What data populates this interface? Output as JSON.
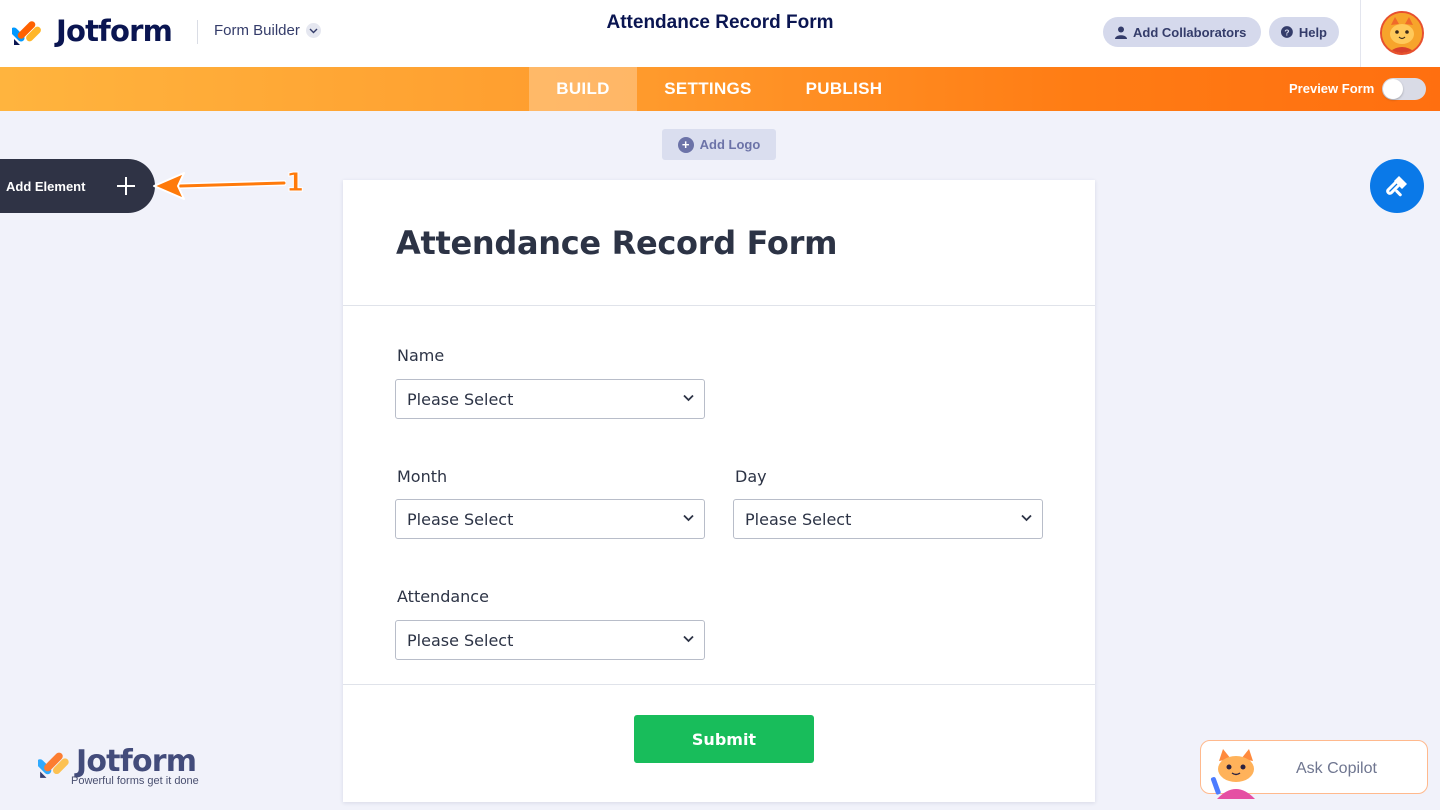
{
  "topbar": {
    "brand": "Jotform",
    "builder_label": "Form Builder",
    "title": "Attendance Record Form",
    "collaborators_label": "Add Collaborators",
    "help_label": "Help"
  },
  "nav": {
    "tabs": [
      {
        "label": "BUILD",
        "active": true
      },
      {
        "label": "SETTINGS",
        "active": false
      },
      {
        "label": "PUBLISH",
        "active": false
      }
    ],
    "preview_label": "Preview Form",
    "preview_on": false
  },
  "canvas": {
    "add_logo_label": "Add Logo",
    "add_element_label": "Add Element",
    "annotation_number": "1"
  },
  "form": {
    "title": "Attendance Record Form",
    "fields": [
      {
        "label": "Name",
        "value": "Please Select"
      },
      {
        "label": "Month",
        "value": "Please Select"
      },
      {
        "label": "Day",
        "value": "Please Select"
      },
      {
        "label": "Attendance",
        "value": "Please Select"
      }
    ],
    "submit_label": "Submit"
  },
  "footer": {
    "brand": "Jotform",
    "tagline": "Powerful forms get it done",
    "copilot_label": "Ask Copilot"
  },
  "colors": {
    "accent_orange": "#ff7c14",
    "submit_green": "#18bd5b",
    "paint_blue": "#0a79e8",
    "navy": "#0a1551"
  }
}
